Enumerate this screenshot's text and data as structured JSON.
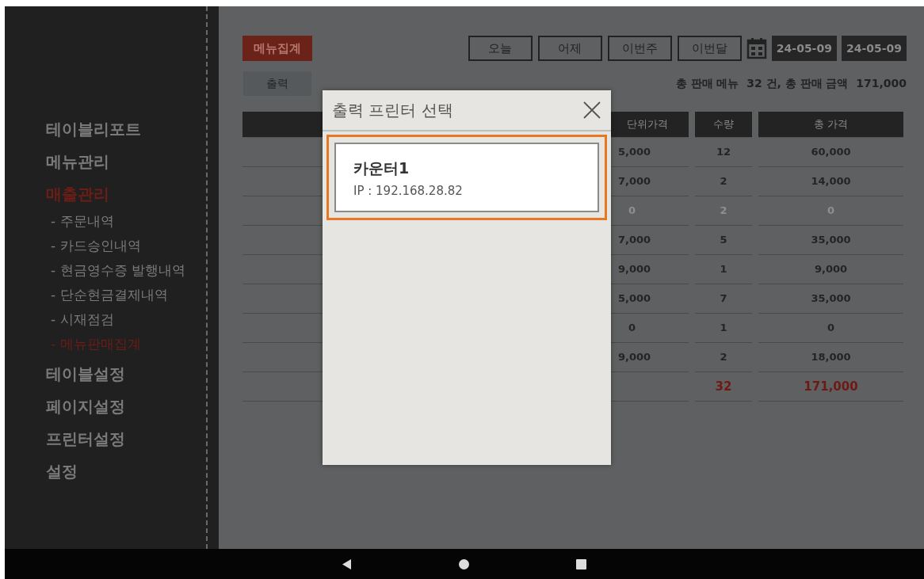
{
  "sidebar": {
    "items": [
      {
        "label": "테이블리포트",
        "selected": false
      },
      {
        "label": "메뉴관리",
        "selected": false
      },
      {
        "label": "매출관리",
        "selected": true,
        "children": [
          {
            "label": "- 주문내역",
            "selected": false
          },
          {
            "label": "- 카드승인내역",
            "selected": false
          },
          {
            "label": "- 현금영수증 발행내역",
            "selected": false
          },
          {
            "label": "- 단순현금결제내역",
            "selected": false
          },
          {
            "label": "- 시재점검",
            "selected": false
          },
          {
            "label": "- 메뉴판매집계",
            "selected": true
          }
        ]
      },
      {
        "label": "테이블설정",
        "selected": false
      },
      {
        "label": "페이지설정",
        "selected": false
      },
      {
        "label": "프린터설정",
        "selected": false
      },
      {
        "label": "설정",
        "selected": false
      }
    ]
  },
  "toolbar": {
    "title_button": "메뉴집계",
    "periods": [
      "오늘",
      "어제",
      "이번주",
      "이번달"
    ],
    "date_from": "24-05-09",
    "date_to": "24-05-09",
    "print_button": "출력",
    "summary": "총 판매 메뉴  32 건, 총 판매 금액  171,000"
  },
  "table": {
    "columns": [
      "",
      "단위가격",
      "수량",
      "총 가격"
    ],
    "rows": [
      {
        "unit_price": "5,000",
        "quantity": "12",
        "total": "60,000",
        "disabled": false
      },
      {
        "unit_price": "7,000",
        "quantity": "2",
        "total": "14,000",
        "disabled": false
      },
      {
        "unit_price": "0",
        "quantity": "2",
        "total": "0",
        "disabled": true
      },
      {
        "unit_price": "7,000",
        "quantity": "5",
        "total": "35,000",
        "disabled": false
      },
      {
        "unit_price": "9,000",
        "quantity": "1",
        "total": "9,000",
        "disabled": false
      },
      {
        "unit_price": "5,000",
        "quantity": "7",
        "total": "35,000",
        "disabled": false
      },
      {
        "unit_price": "0",
        "quantity": "1",
        "total": "0",
        "disabled": false
      },
      {
        "unit_price": "9,000",
        "quantity": "2",
        "total": "18,000",
        "disabled": false
      }
    ],
    "totals": {
      "quantity": "32",
      "total": "171,000"
    }
  },
  "dialog": {
    "title": "출력 프린터 선택",
    "printers": [
      {
        "name": "카운터1",
        "ip": "IP : 192.168.28.82",
        "selected": true
      }
    ]
  }
}
